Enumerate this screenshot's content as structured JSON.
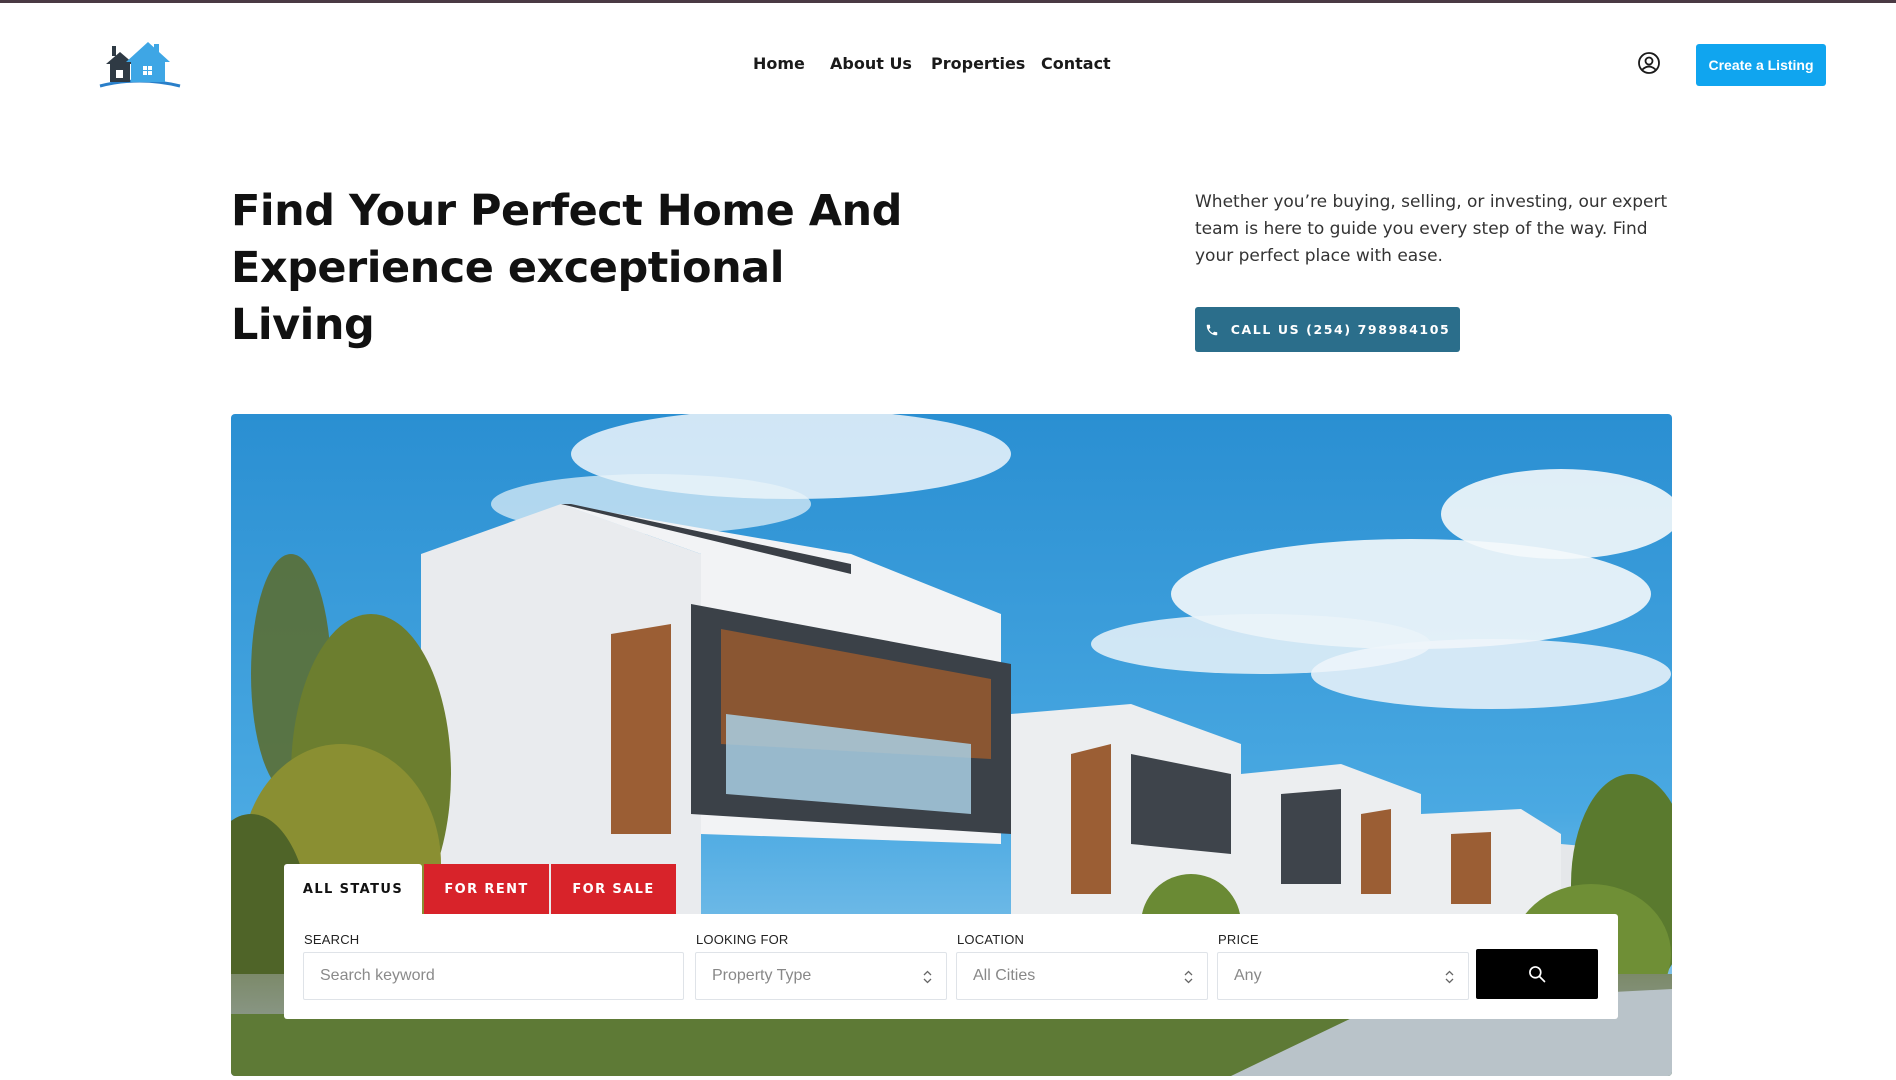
{
  "colors": {
    "accent": "#10a5ef",
    "call_button": "#2b6e8b",
    "tab_red": "#d8232a",
    "search_button": "#000000"
  },
  "header": {
    "logo_icon": "house-logo-icon",
    "nav": [
      "Home",
      "About Us",
      "Properties",
      "Contact"
    ],
    "user_icon": "user-circle-icon",
    "create_listing_label": "Create a Listing"
  },
  "hero": {
    "title_lines": [
      "Find Your Perfect Home And",
      "Experience exceptional",
      "Living"
    ],
    "description": "Whether you’re buying, selling, or investing, our expert team is here to guide you every step of the way. Find your perfect place with ease.",
    "call_button_label": "CALL US (254) 798984105",
    "call_icon": "phone-icon",
    "image_subject": "modern-houses-photo"
  },
  "search": {
    "tabs": [
      "ALL STATUS",
      "FOR RENT",
      "FOR SALE"
    ],
    "active_tab": "ALL STATUS",
    "fields": {
      "search": {
        "label": "SEARCH",
        "placeholder": "Search keyword"
      },
      "looking_for": {
        "label": "LOOKING FOR",
        "value": "Property Type"
      },
      "location": {
        "label": "LOCATION",
        "value": "All Cities"
      },
      "price": {
        "label": "PRICE",
        "value": "Any"
      }
    },
    "submit_icon": "search-icon"
  }
}
